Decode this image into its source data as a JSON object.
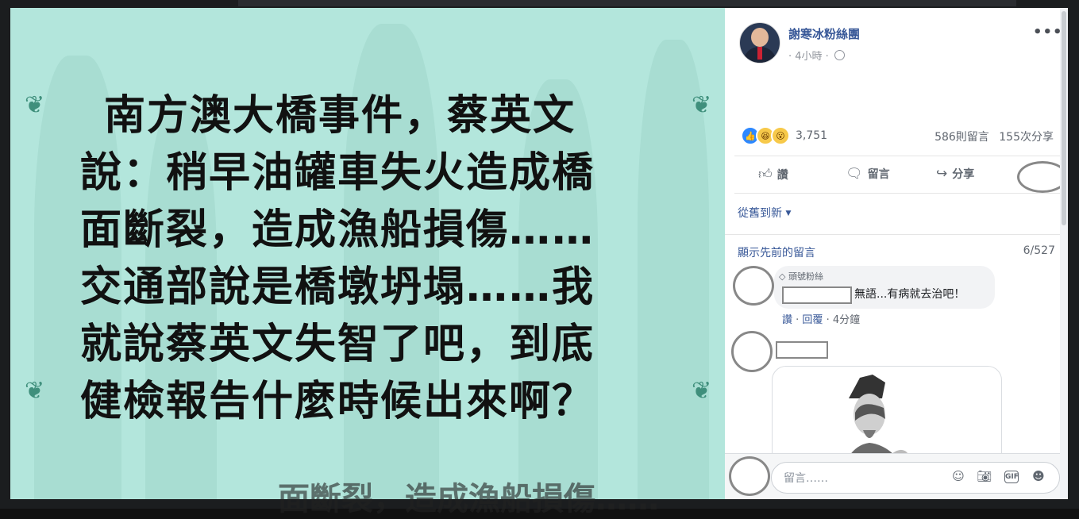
{
  "photo": {
    "lines": [
      "南方澳大橋事件，蔡英文",
      "說：稍早油罐車失火造成橋",
      "面斷裂，造成漁船損傷……",
      "交通部說是橋墩坍塌……我",
      "就說蔡英文失智了吧，到底",
      "健檢報告什麼時候出來啊？"
    ],
    "bottom_text": "面斷裂，造成漁船損傷……",
    "colors": {
      "background": "#b3e6dc",
      "text": "#111111"
    }
  },
  "post": {
    "page_name": "謝寒冰粉絲團",
    "time": "· 4小時 ·",
    "more": "•••",
    "reaction_count": "3,751",
    "comments_count": "586則留言",
    "shares_count": "155次分享",
    "reaction_icons": [
      "like-icon",
      "haha-icon",
      "wow-icon"
    ]
  },
  "actions": {
    "like": "讚",
    "comment": "留言",
    "share": "分享"
  },
  "comments": {
    "sort_label": "從舊到新",
    "prev_label": "顯示先前的留言",
    "counter": "6/527",
    "items": [
      {
        "badge": "頭號粉絲",
        "text": "無語...有病就去治吧！",
        "like": "讚",
        "reply": "回覆",
        "time": "4分鐘"
      }
    ],
    "compose_placeholder": "留言……"
  },
  "colors": {
    "link": "#385898",
    "accent": "#2d88ff",
    "muted": "#616770"
  }
}
